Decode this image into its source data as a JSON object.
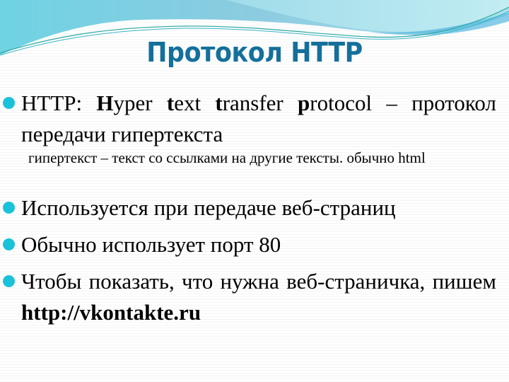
{
  "slide": {
    "title": "Протокол HTTP",
    "colors": {
      "title": "#14709b",
      "bullet": "#19c2d8",
      "wave_light": "#a8dfe8",
      "wave_mid": "#7fcfe0",
      "wave_line": "#2aa8a0"
    },
    "bullets": [
      {
        "parts": [
          {
            "text": "HTTP: ",
            "bold": false
          },
          {
            "text": "H",
            "bold": true
          },
          {
            "text": "yper ",
            "bold": false
          },
          {
            "text": "t",
            "bold": true
          },
          {
            "text": "ext ",
            "bold": false
          },
          {
            "text": "t",
            "bold": true
          },
          {
            "text": "ransfer ",
            "bold": false
          },
          {
            "text": "p",
            "bold": true
          },
          {
            "text": "rotocol – протокол передачи гипертекста",
            "bold": false
          }
        ],
        "sub": "гипертекст – текст со ссылками на другие тексты.  обычно html"
      },
      {
        "text": "Используется при передаче веб-страниц"
      },
      {
        "text": "Обычно использует порт 80"
      },
      {
        "text": "Чтобы показать, что нужна веб-страничка, пишем ",
        "bold_suffix": "http://vkontakte.ru"
      }
    ]
  }
}
